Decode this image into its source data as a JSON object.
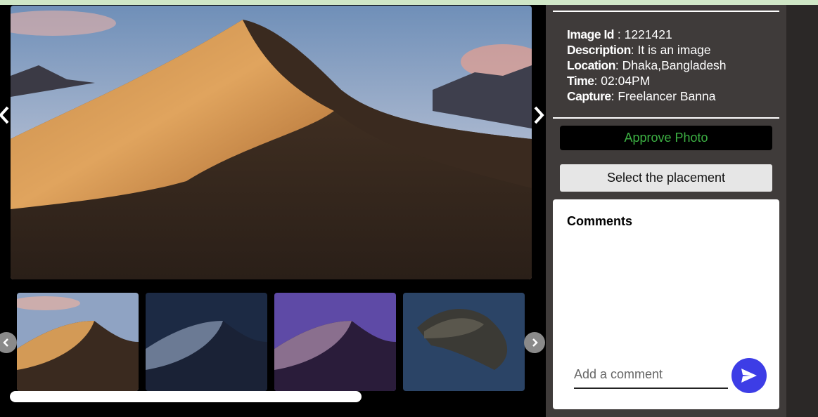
{
  "gallery": {
    "main_image": {
      "subject": "desert-dune-day"
    },
    "prev_icon": "chevron-left-icon",
    "next_icon": "chevron-right-icon",
    "thumbnails": [
      {
        "subject": "desert-dune-day"
      },
      {
        "subject": "desert-dune-night"
      },
      {
        "subject": "desert-dune-purple"
      },
      {
        "subject": "island-catalina"
      }
    ],
    "scroll_progress": 0.66
  },
  "details": {
    "image_id_label": "Image Id",
    "image_id_value": " : 1221421",
    "description_label": "Description",
    "description_value": ": It is an image",
    "location_label": "Location",
    "location_value": ": Dhaka,Bangladesh",
    "time_label": "Time",
    "time_value": ": 02:04PM",
    "capture_label": "Capture",
    "capture_value": ": Freelancer Banna"
  },
  "actions": {
    "approve_label": "Approve Photo",
    "placement_label": "Select the placement"
  },
  "comments": {
    "title": "Comments",
    "input_placeholder": "Add a comment",
    "send_icon": "send-icon"
  },
  "colors": {
    "panel_bg": "#3f3b3a",
    "approve_text": "#3cb043",
    "send_button": "#3d3de6"
  }
}
